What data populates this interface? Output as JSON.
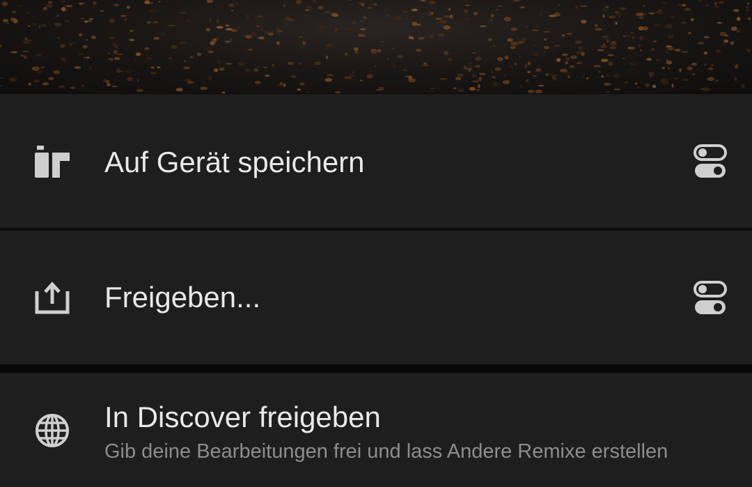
{
  "menu": {
    "items": [
      {
        "label": "Auf Gerät speichern",
        "icon": "save-to-device-icon",
        "trailing_icon": "settings-toggle-icon"
      },
      {
        "label": "Freigeben...",
        "icon": "share-icon",
        "trailing_icon": "settings-toggle-icon"
      },
      {
        "label": "In Discover freigeben",
        "description": "Gib deine Bearbeitungen frei und lass Andere Remixe erstellen",
        "icon": "globe-icon"
      }
    ]
  },
  "colors": {
    "sheet_background": "#1e1e1e",
    "primary_text": "#e9e9e9",
    "secondary_text": "#8d8d8d",
    "icon": "#cfcfcf"
  }
}
